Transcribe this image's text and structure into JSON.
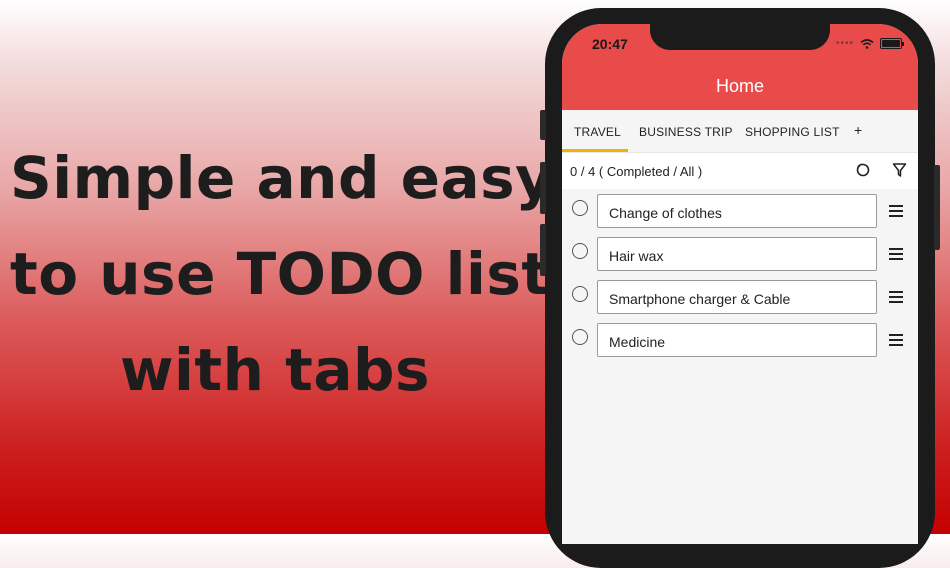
{
  "headline": {
    "line1": "Simple and easy",
    "line2": "to use TODO list",
    "line3": "with tabs"
  },
  "status_bar": {
    "time": "20:47"
  },
  "app_bar": {
    "title": "Home",
    "color": "#e94a4a"
  },
  "tabs": [
    {
      "label": "TRAVEL",
      "active": true
    },
    {
      "label": "BUSINESS TRIP",
      "active": false
    },
    {
      "label": "SHOPPING LIST",
      "active": false
    },
    {
      "label": "+",
      "active": false
    }
  ],
  "summary": {
    "text": "0 / 4 ( Completed / All )"
  },
  "todos": [
    {
      "text": "Change of clothes",
      "done": false
    },
    {
      "text": "Hair wax",
      "done": false
    },
    {
      "text": "Smartphone charger & Cable",
      "done": false
    },
    {
      "text": "Medicine",
      "done": false
    }
  ],
  "icons": {
    "reset": "reset-icon",
    "filter": "filter-icon",
    "drag": "drag-handle-icon",
    "checkbox": "checkbox-circle-icon",
    "wifi": "wifi-icon",
    "battery": "battery-icon"
  },
  "colors": {
    "tab_indicator": "#f0b400",
    "background_bottom": "#c40000"
  }
}
